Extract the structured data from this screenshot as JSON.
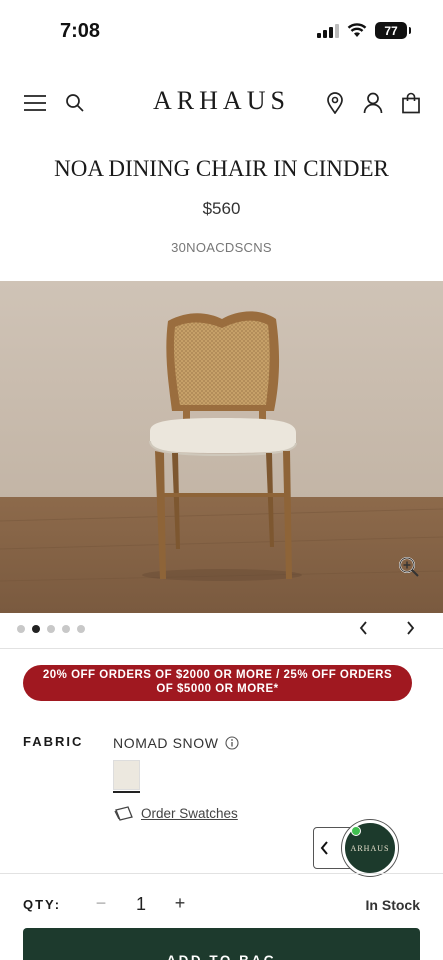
{
  "status_bar": {
    "time": "7:08",
    "battery": "77"
  },
  "header": {
    "logo": "ARHAUS",
    "icons": [
      "menu-icon",
      "search-icon",
      "location-icon",
      "account-icon",
      "bag-icon"
    ]
  },
  "product": {
    "title": "NOA DINING CHAIR IN CINDER",
    "price": "$560",
    "sku": "30NOACDSCNS"
  },
  "carousel": {
    "slide_count": 5,
    "active_index": 1
  },
  "promo": {
    "line1": "20% OFF ORDERS OF $2000 OR MORE / 25% OFF ORDERS",
    "line2": "OF $5000 OR MORE*",
    "color": "#a01820"
  },
  "fabric": {
    "label": "FABRIC",
    "selected": "NOMAD SNOW",
    "swatch_color": "#ece8df",
    "order_swatches": "Order Swatches"
  },
  "chat": {
    "logo": "ARHAUS"
  },
  "quantity": {
    "label": "QTY:",
    "minus": "−",
    "value": "1",
    "plus": "+"
  },
  "stock_status": "In Stock",
  "add_to_bag": {
    "label": "ADD TO BAG",
    "color": "#1d3a2d"
  }
}
